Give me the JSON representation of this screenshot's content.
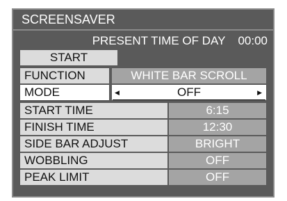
{
  "title": "SCREENSAVER",
  "present": {
    "label": "PRESENT TIME OF DAY",
    "time": "00:00"
  },
  "start_label": "START",
  "function": {
    "label": "FUNCTION",
    "value": "WHITE BAR SCROLL"
  },
  "mode": {
    "label": "MODE",
    "value": "OFF"
  },
  "rows": [
    {
      "label": "START TIME",
      "value": "6:15"
    },
    {
      "label": "FINISH TIME",
      "value": "12:30"
    },
    {
      "label": "SIDE BAR ADJUST",
      "value": "BRIGHT"
    },
    {
      "label": "WOBBLING",
      "value": "OFF"
    },
    {
      "label": "PEAK LIMIT",
      "value": "OFF"
    }
  ],
  "colors": {
    "panel": "#5a5a5a",
    "border": "#8a8a8a",
    "label_bg": "#dcdcdc",
    "value_bg": "#a4a4a4",
    "selected_bg": "#ffffff"
  }
}
